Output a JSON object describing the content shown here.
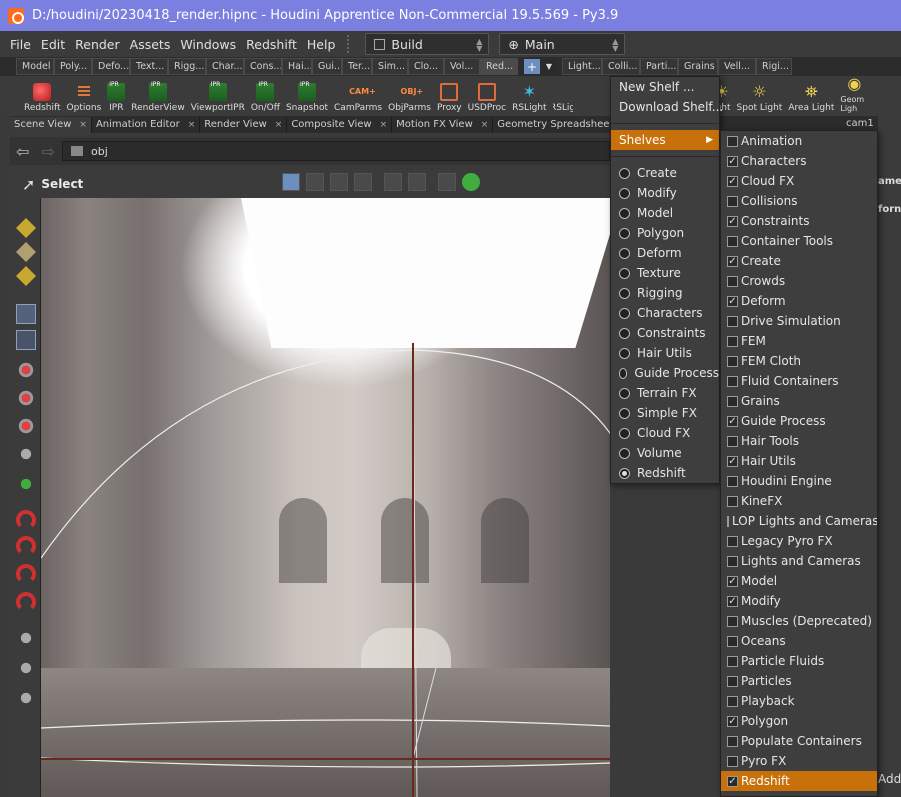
{
  "window": {
    "title": "D:/houdini/20230418_render.hipnc - Houdini Apprentice Non-Commercial 19.5.569 - Py3.9"
  },
  "menubar": {
    "items": [
      "File",
      "Edit",
      "Render",
      "Assets",
      "Windows",
      "Redshift",
      "Help"
    ],
    "desktop": "Build",
    "context": "Main"
  },
  "shelf_tabs": [
    "Model",
    "Poly...",
    "Defo...",
    "Text...",
    "Rigg...",
    "Char...",
    "Cons...",
    "Hai...",
    "Gui...",
    "Ter...",
    "Sim...",
    "Clo...",
    "Vol...",
    "Red...",
    "Light...",
    "Colli...",
    "Parti...",
    "Grains",
    "Vell...",
    "Rigi..."
  ],
  "tools_left": [
    "Redshift",
    "Options",
    "IPR",
    "RenderView",
    "ViewportIPR",
    "On/Off",
    "Snapshot",
    "CamParms",
    "ObjParms",
    "Proxy",
    "USDProc",
    "RSLight",
    "RSLig"
  ],
  "tools_right": [
    "Point Light",
    "Spot Light",
    "Area Light",
    "Geom Ligh"
  ],
  "cam_labels": {
    "camp": "CAM+",
    "objp": "OBJ+"
  },
  "pane_tabs": [
    "Scene View",
    "Animation Editor",
    "Render View",
    "Composite View",
    "Motion FX View",
    "Geometry Spreadsheet"
  ],
  "right_pane_tab": "cam1",
  "right_edge": [
    "ame",
    "forn",
    "Add"
  ],
  "path": "obj",
  "select_label": "Select",
  "dropdown": {
    "new_shelf": "New Shelf ...",
    "download_shelf": "Download Shelf...",
    "shelves": "Shelves",
    "shelves_arrow": "▶",
    "sets": [
      {
        "label": "Create",
        "selected": false
      },
      {
        "label": "Modify",
        "selected": false
      },
      {
        "label": "Model",
        "selected": false
      },
      {
        "label": "Polygon",
        "selected": false
      },
      {
        "label": "Deform",
        "selected": false
      },
      {
        "label": "Texture",
        "selected": false
      },
      {
        "label": "Rigging",
        "selected": false
      },
      {
        "label": "Characters",
        "selected": false
      },
      {
        "label": "Constraints",
        "selected": false
      },
      {
        "label": "Hair Utils",
        "selected": false
      },
      {
        "label": "Guide Process",
        "selected": false
      },
      {
        "label": "Terrain FX",
        "selected": false
      },
      {
        "label": "Simple FX",
        "selected": false
      },
      {
        "label": "Cloud FX",
        "selected": false
      },
      {
        "label": "Volume",
        "selected": false
      },
      {
        "label": "Redshift",
        "selected": true
      }
    ]
  },
  "shelves_submenu": [
    {
      "label": "Animation",
      "checked": false
    },
    {
      "label": "Characters",
      "checked": true
    },
    {
      "label": "Cloud FX",
      "checked": true
    },
    {
      "label": "Collisions",
      "checked": false
    },
    {
      "label": "Constraints",
      "checked": true
    },
    {
      "label": "Container Tools",
      "checked": false
    },
    {
      "label": "Create",
      "checked": true
    },
    {
      "label": "Crowds",
      "checked": false
    },
    {
      "label": "Deform",
      "checked": true
    },
    {
      "label": "Drive Simulation",
      "checked": false
    },
    {
      "label": "FEM",
      "checked": false
    },
    {
      "label": "FEM Cloth",
      "checked": false
    },
    {
      "label": "Fluid Containers",
      "checked": false
    },
    {
      "label": "Grains",
      "checked": false
    },
    {
      "label": "Guide Process",
      "checked": true
    },
    {
      "label": "Hair Tools",
      "checked": false
    },
    {
      "label": "Hair Utils",
      "checked": true
    },
    {
      "label": "Houdini Engine",
      "checked": false
    },
    {
      "label": "KineFX",
      "checked": false
    },
    {
      "label": "LOP Lights and Cameras",
      "checked": false
    },
    {
      "label": "Legacy Pyro FX",
      "checked": false
    },
    {
      "label": "Lights and Cameras",
      "checked": false
    },
    {
      "label": "Model",
      "checked": true
    },
    {
      "label": "Modify",
      "checked": true
    },
    {
      "label": "Muscles (Deprecated)",
      "checked": false
    },
    {
      "label": "Oceans",
      "checked": false
    },
    {
      "label": "Particle Fluids",
      "checked": false
    },
    {
      "label": "Particles",
      "checked": false
    },
    {
      "label": "Playback",
      "checked": false
    },
    {
      "label": "Polygon",
      "checked": true
    },
    {
      "label": "Populate Containers",
      "checked": false
    },
    {
      "label": "Pyro FX",
      "checked": false
    },
    {
      "label": "Redshift",
      "checked": true,
      "highlighted": true
    }
  ],
  "colors": {
    "accent": "#c8700a",
    "titlebar": "#7a7fe0"
  }
}
